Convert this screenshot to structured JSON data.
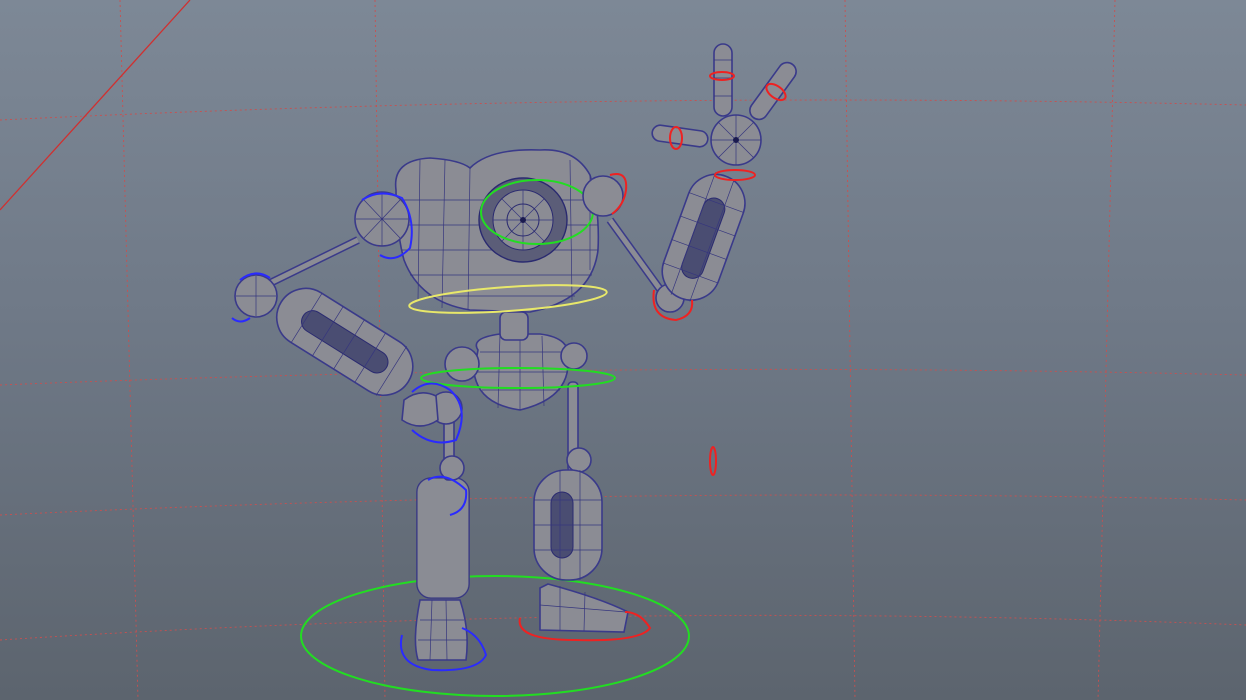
{
  "viewport": {
    "background_top": "#7d8896",
    "background_bottom": "#5c646e",
    "grid_color": "#c85050",
    "axis_color": "#d03030",
    "mesh_fill": "#8b8c94",
    "wire_color": "#36367e"
  },
  "controls": {
    "root_color": "#22dd22",
    "cog_color": "#22dd22",
    "hip_color": "#e8e86a",
    "head_color": "#22dd22",
    "left_side_color": "#2a2aff",
    "right_side_color": "#ee2222"
  }
}
